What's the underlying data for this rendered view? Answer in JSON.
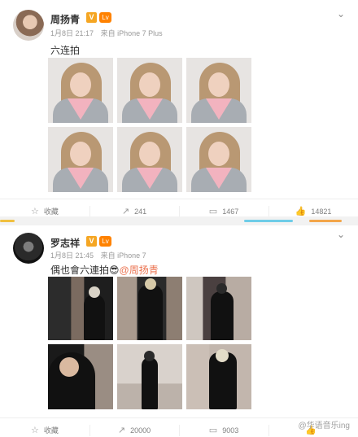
{
  "posts": [
    {
      "user": "周扬青",
      "v_badge": "V",
      "level_badge": "Lv",
      "date": "1月8日 21:17",
      "source": "来自 iPhone 7 Plus",
      "text": "六连拍",
      "actions": {
        "favorite": "收藏",
        "repost": "241",
        "comment": "1467",
        "like": "14821"
      }
    },
    {
      "user": "罗志祥",
      "v_badge": "V",
      "level_badge": "Lv",
      "date": "1月8日 21:45",
      "source": "来自 iPhone 7",
      "text": "偶也會六連拍😎",
      "mention": "@周扬青",
      "actions": {
        "favorite": "收藏",
        "repost": "20000",
        "comment": "9003",
        "like": ""
      }
    }
  ],
  "icons": {
    "favorite": "star-icon",
    "repost": "repost-icon",
    "comment": "comment-icon",
    "like": "thumb-up-icon",
    "menu": "chevron-down-icon"
  },
  "watermark": "@华语音乐ing",
  "colors": {
    "mention": "#eb7350",
    "vip": "#f5a623",
    "level": "#ff8200"
  }
}
